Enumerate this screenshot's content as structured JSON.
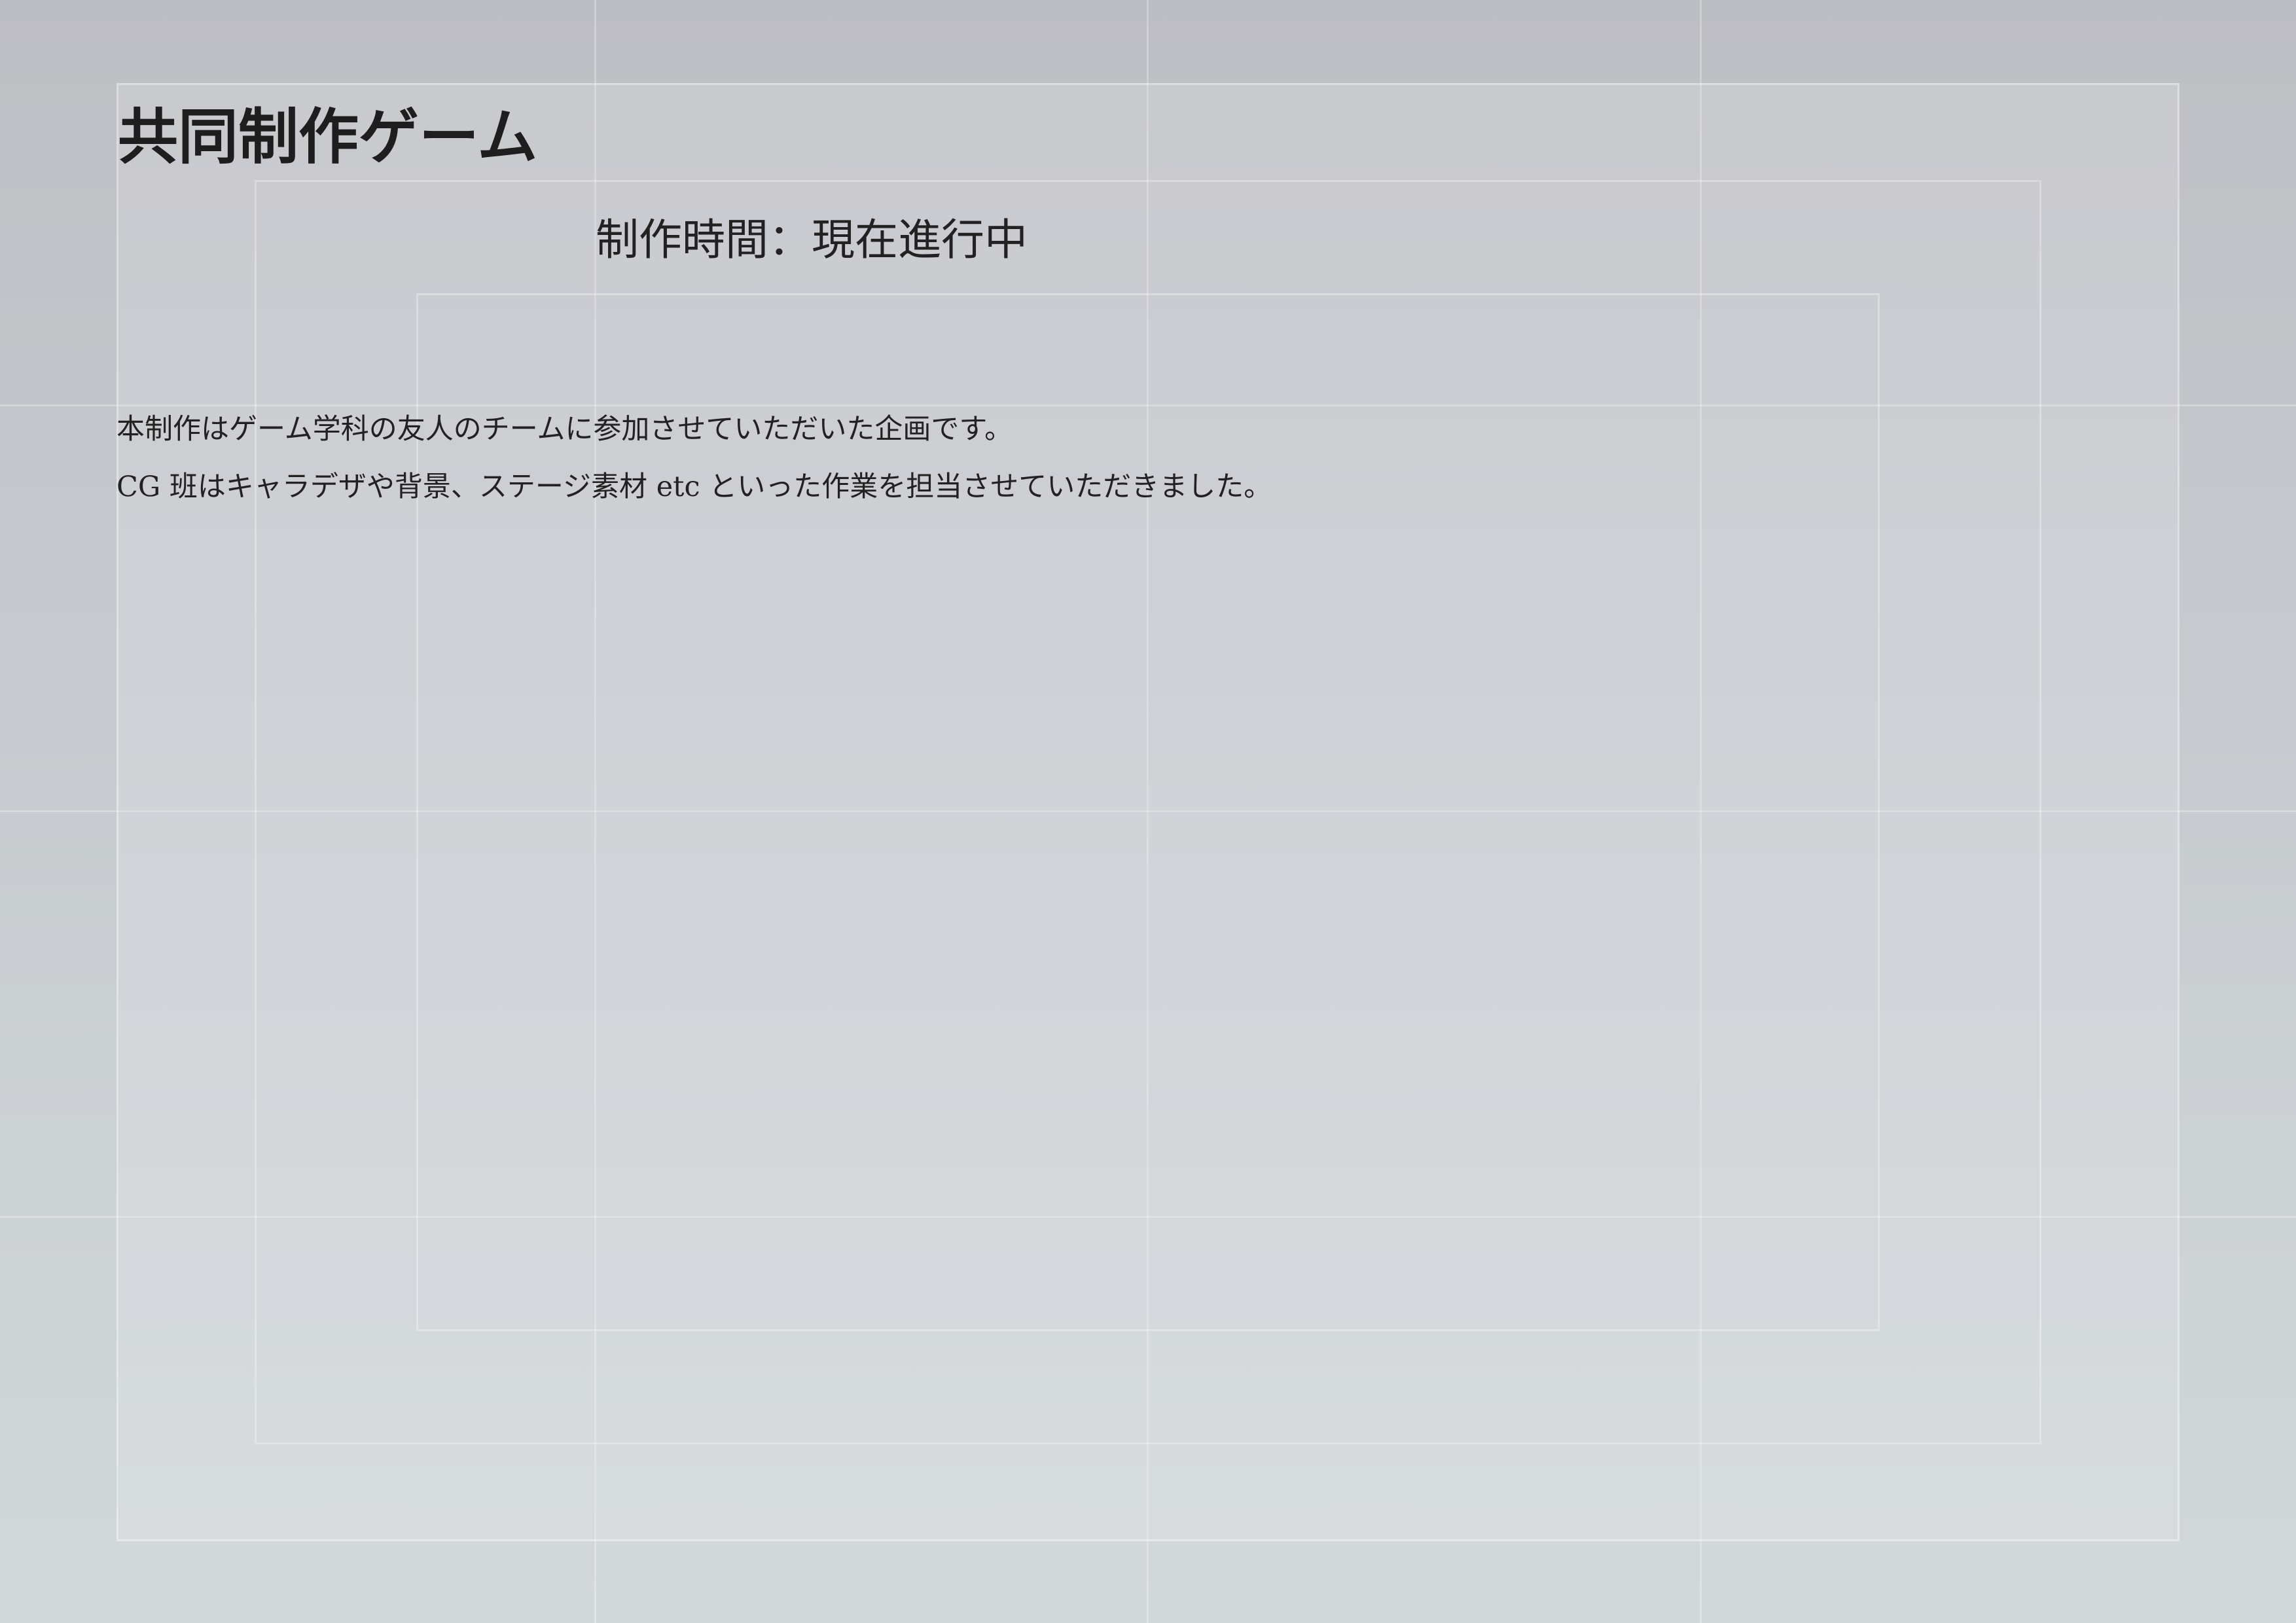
{
  "page": {
    "title": "共同制作ゲーム",
    "subtitle": "制作時間：現在進行中",
    "description": [
      "本制作はゲーム学科の友人のチームに参加させていただいた企画です。",
      "CG 班はキャラデザや背景、ステージ素材 etc といった作業を担当させていただきました。"
    ]
  },
  "colors": {
    "text": "#1e1e1e",
    "background_top": "#bdbec3",
    "background_bottom": "#d2d8da"
  }
}
